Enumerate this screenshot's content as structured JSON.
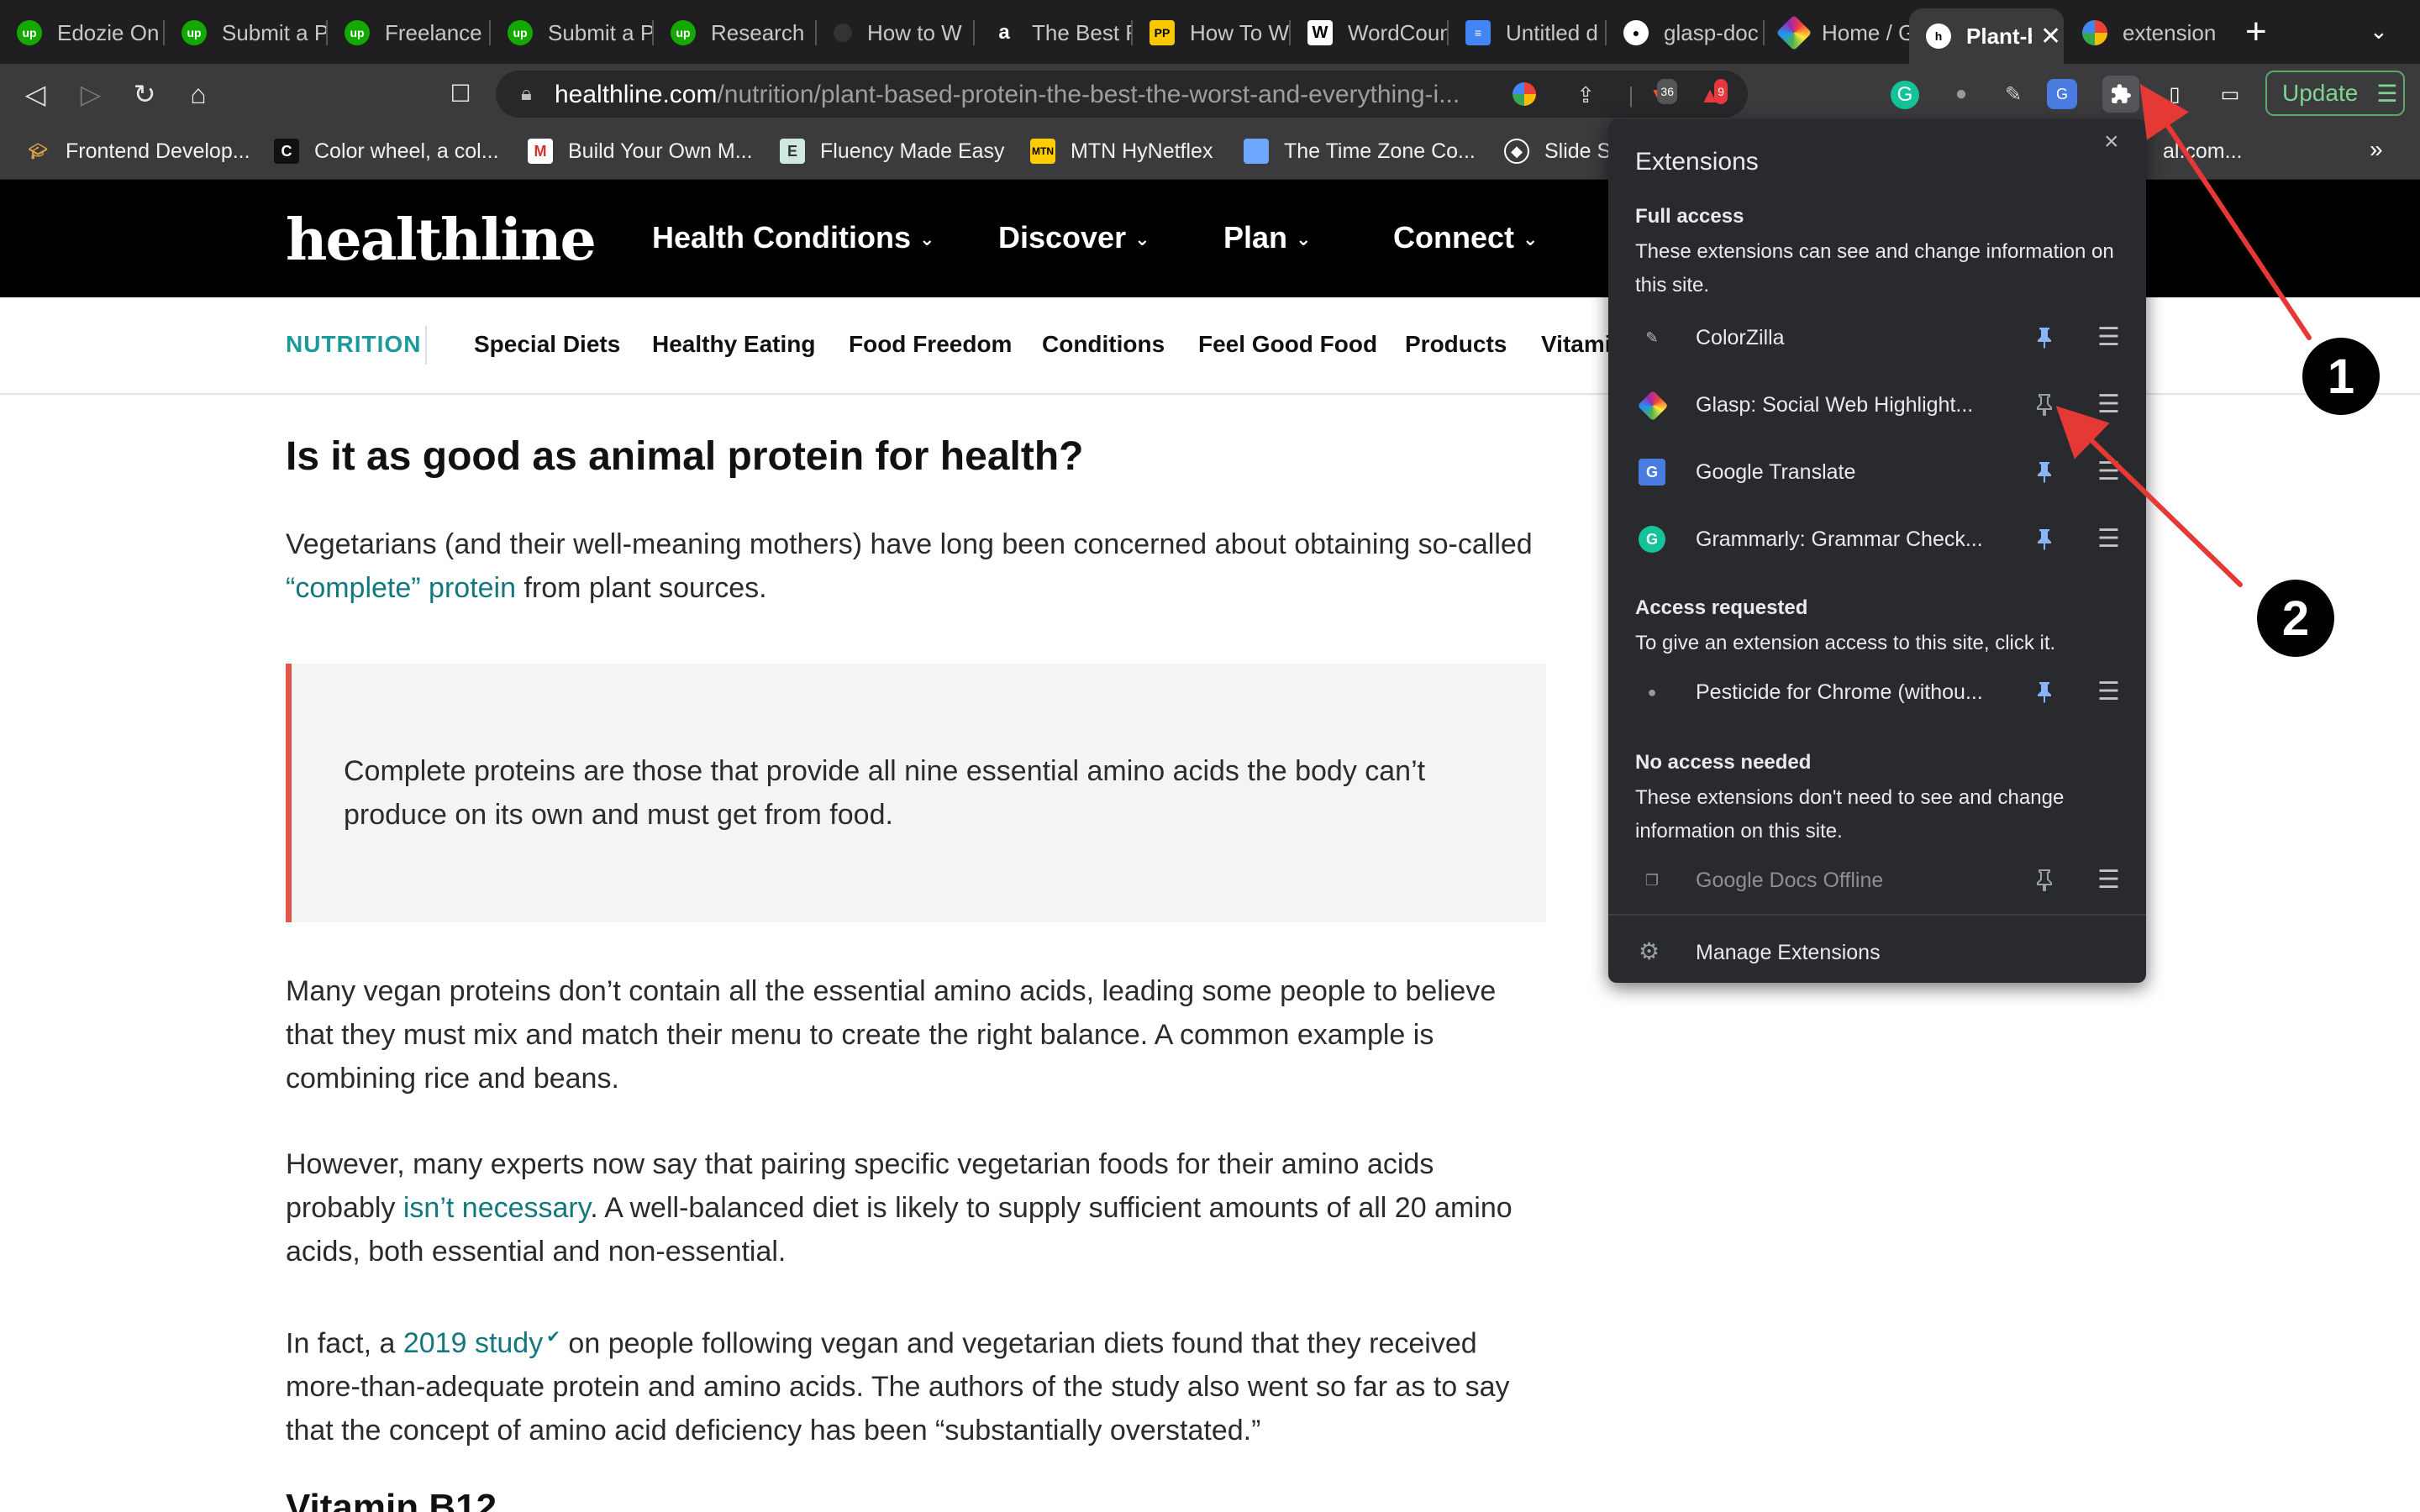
{
  "browser": {
    "tabs": [
      {
        "label": "Edozie On",
        "icon": "upwork-icon"
      },
      {
        "label": "Submit a P",
        "icon": "upwork-icon"
      },
      {
        "label": "Freelance",
        "icon": "upwork-icon"
      },
      {
        "label": "Submit a P",
        "icon": "upwork-icon"
      },
      {
        "label": "Research",
        "icon": "upwork-icon"
      },
      {
        "label": "How to W",
        "icon": "circle-icon"
      },
      {
        "label": "The Best F",
        "icon": "amazon-icon"
      },
      {
        "label": "How To W",
        "icon": "pp-icon"
      },
      {
        "label": "WordCoun",
        "icon": "w-icon"
      },
      {
        "label": "Untitled d",
        "icon": "docs-icon"
      },
      {
        "label": "glasp-doc",
        "icon": "github-icon"
      },
      {
        "label": "Home / Gl",
        "icon": "glasp-icon"
      },
      {
        "label": "Plant-b",
        "icon": "healthline-icon",
        "active": true
      },
      {
        "label": "extension",
        "icon": "google-icon"
      }
    ],
    "new_tab": "+",
    "url_host": "healthline.com",
    "url_path": "/nutrition/plant-based-protein-the-best-the-worst-and-everything-i...",
    "brave_badge": "36",
    "alert_badge": "9",
    "update_label": "Update",
    "bookmarks": [
      {
        "label": "Frontend Develop...",
        "icon": "grad-cap-icon"
      },
      {
        "label": "Color wheel, a col...",
        "icon": "color-wheel-icon"
      },
      {
        "label": "Build Your Own M...",
        "icon": "m-icon"
      },
      {
        "label": "Fluency Made Easy",
        "icon": "e-icon"
      },
      {
        "label": "MTN HyNetflex",
        "icon": "mtn-icon"
      },
      {
        "label": "The Time Zone Co...",
        "icon": "calendar-icon"
      },
      {
        "label": "Slide S",
        "icon": "slide-icon"
      }
    ],
    "bookmark_overflow_text": "al.com...",
    "bookmarks_more": "»"
  },
  "site": {
    "logo": "healthline",
    "nav": [
      "Health Conditions",
      "Discover",
      "Plan",
      "Connect"
    ],
    "subnav_category": "NUTRITION",
    "subnav": [
      "Special Diets",
      "Healthy Eating",
      "Food Freedom",
      "Conditions",
      "Feel Good Food",
      "Products",
      "Vitami"
    ]
  },
  "article": {
    "heading": "Is it as good as animal protein for health?",
    "p1_before": "Vegetarians (and their well-meaning mothers) have long been concerned about obtaining so-called ",
    "p1_link": "“complete” protein",
    "p1_after": " from plant sources.",
    "callout": "Complete proteins are those that provide all nine essential amino acids the body can’t produce on its own and must get from food.",
    "p2": "Many vegan proteins don’t contain all the essential amino acids, leading some people to believe that they must mix and match their menu to create the right balance. A common example is combining rice and beans.",
    "p3_before": "However, many experts now say that pairing specific vegetarian foods for their amino acids probably ",
    "p3_link": "isn’t necessary",
    "p3_after": ". A well-balanced diet is likely to supply sufficient amounts of all 20 amino acids, both essential and non-essential.",
    "p4_before": "In fact, a ",
    "p4_link": "2019 study",
    "p4_after": " on people following vegan and vegetarian diets found that they received more-than-adequate protein and amino acids. The authors of the study also went so far as to say that the concept of amino acid deficiency has been “substantially overstated.”",
    "next_heading": "Vitamin B12"
  },
  "extensions_popup": {
    "title": "Extensions",
    "close": "×",
    "full_access_title": "Full access",
    "full_access_desc": "These extensions can see and change information on this site.",
    "full_access": [
      {
        "name": "ColorZilla",
        "pinned": true,
        "icon": "colorzilla-icon"
      },
      {
        "name": "Glasp: Social Web Highlight...",
        "pinned": false,
        "icon": "glasp-icon"
      },
      {
        "name": "Google Translate",
        "pinned": true,
        "icon": "google-translate-icon"
      },
      {
        "name": "Grammarly: Grammar Check...",
        "pinned": true,
        "icon": "grammarly-icon"
      }
    ],
    "access_requested_title": "Access requested",
    "access_requested_desc": "To give an extension access to this site, click it.",
    "access_requested": [
      {
        "name": "Pesticide for Chrome (withou...",
        "pinned": true,
        "icon": "pesticide-icon"
      }
    ],
    "no_access_title": "No access needed",
    "no_access_desc": "These extensions don't need to see and change information on this site.",
    "no_access": [
      {
        "name": "Google Docs Offline",
        "pinned": false,
        "icon": "google-docs-offline-icon"
      }
    ],
    "manage_label": "Manage Extensions"
  },
  "annotations": {
    "step1": "1",
    "step2": "2",
    "arrow_color": "#e53935"
  },
  "colors": {
    "pin_active": "#8ab4f8",
    "link": "#13787d",
    "callout_border": "#e2574c"
  }
}
